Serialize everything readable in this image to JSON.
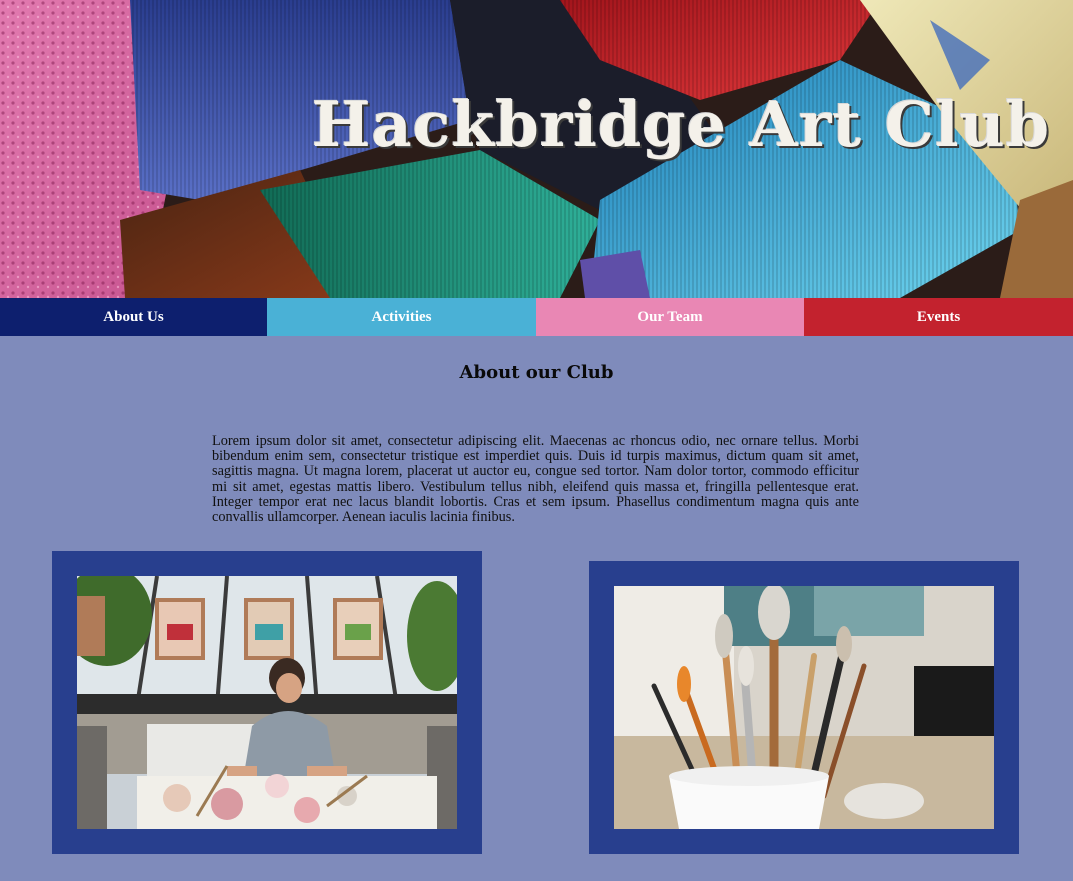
{
  "header": {
    "title": "Hackbridge Art Club"
  },
  "nav": {
    "items": [
      {
        "label": "About Us",
        "color": "#0d1f6e"
      },
      {
        "label": "Activities",
        "color": "#4ab1d6"
      },
      {
        "label": "Our Team",
        "color": "#e987b4"
      },
      {
        "label": "Events",
        "color": "#c3222e"
      }
    ]
  },
  "main": {
    "heading": "About our Club",
    "intro": "Lorem ipsum dolor sit amet, consectetur adipiscing elit. Maecenas ac rhoncus odio, nec ornare tellus. Morbi bibendum enim sem, consectetur tristique est imperdiet quis. Duis id turpis maximus, dictum quam sit amet, sagittis magna. Ut magna lorem, placerat ut auctor eu, congue sed tortor. Nam dolor tortor, commodo efficitur mi sit amet, egestas mattis libero. Vestibulum tellus nibh, eleifend quis massa et, fringilla pellentesque erat. Integer tempor erat nec lacus blandit lobortis. Cras et sem ipsum. Phasellus condimentum magna quis ante convallis ullamcorper. Aenean iaculis lacinia finibus."
  },
  "colors": {
    "page_background": "#7f8bbb",
    "frame": "#283f8e"
  }
}
